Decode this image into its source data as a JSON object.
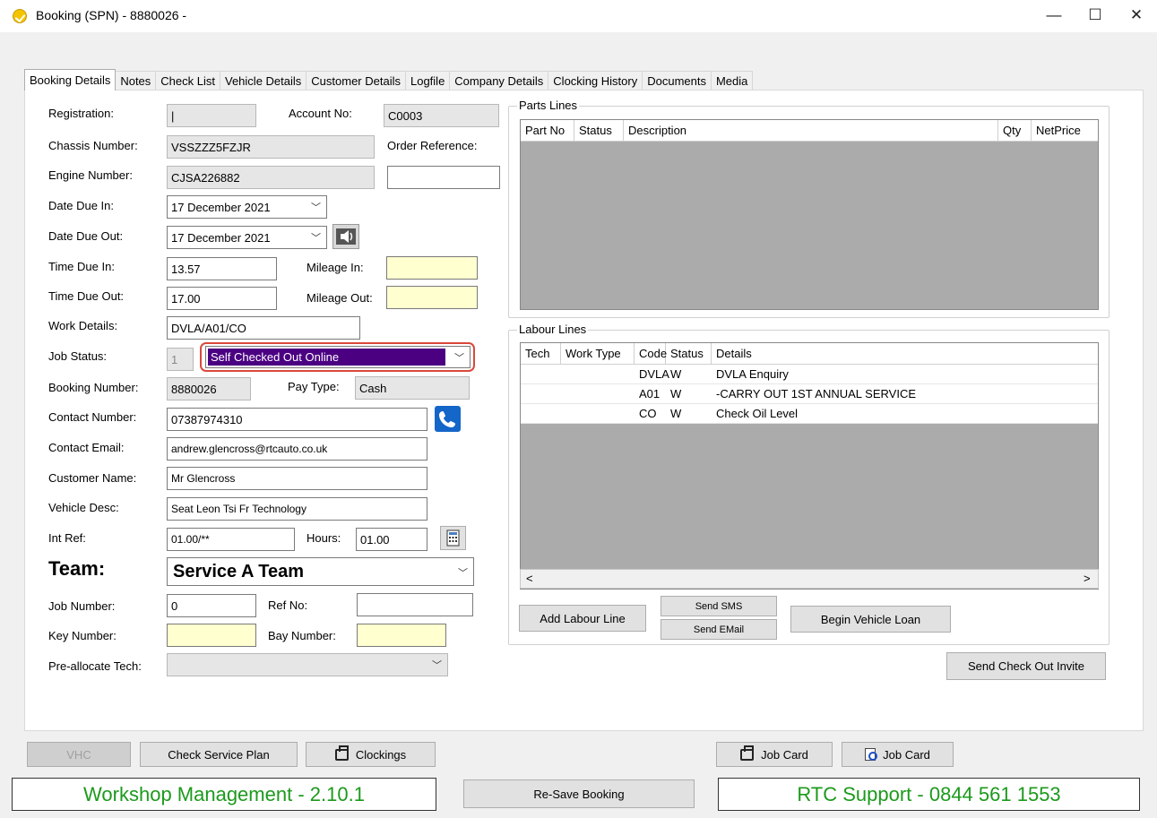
{
  "window": {
    "title": "Booking (SPN) - 8880026 -",
    "minimize": "—",
    "maximize": "☐",
    "close": "✕"
  },
  "tabs": [
    "Booking Details",
    "Notes",
    "Check List",
    "Vehicle Details",
    "Customer Details",
    "Logfile",
    "Company Details",
    "Clocking History",
    "Documents",
    "Media"
  ],
  "form": {
    "registration_label": "Registration:",
    "registration": "|",
    "account_no_label": "Account No:",
    "account_no": "C0003",
    "chassis_label": "Chassis Number:",
    "chassis": "VSSZZZ5FZJR",
    "order_ref_label": "Order Reference:",
    "order_ref": "",
    "engine_label": "Engine Number:",
    "engine": "CJSA226882",
    "date_in_label": "Date Due In:",
    "date_in": "17 December 2021",
    "date_out_label": "Date Due Out:",
    "date_out": "17 December 2021",
    "time_in_label": "Time Due In:",
    "time_in": "13.57",
    "mileage_in_label": "Mileage In:",
    "mileage_in": "",
    "time_out_label": "Time Due Out:",
    "time_out": "17.00",
    "mileage_out_label": "Mileage Out:",
    "mileage_out": "",
    "work_details_label": "Work Details:",
    "work_details": "DVLA/A01/CO",
    "job_status_label": "Job Status:",
    "job_status_code": "1",
    "job_status": "Self Checked Out Online",
    "booking_number_label": "Booking Number:",
    "booking_number": "8880026",
    "pay_type_label": "Pay Type:",
    "pay_type": "Cash",
    "contact_number_label": "Contact Number:",
    "contact_number": "07387974310",
    "contact_email_label": "Contact Email:",
    "contact_email": "andrew.glencross@rtcauto.co.uk",
    "customer_name_label": "Customer Name:",
    "customer_name": "Mr Glencross",
    "vehicle_desc_label": "Vehicle Desc:",
    "vehicle_desc": "Seat Leon Tsi Fr Technology",
    "int_ref_label": "Int Ref:",
    "int_ref": "01.00/**",
    "hours_label": "Hours:",
    "hours": "01.00",
    "team_label": "Team:",
    "team": "Service A Team",
    "job_number_label": "Job Number:",
    "job_number": "0",
    "ref_no_label": "Ref No:",
    "ref_no": "",
    "key_number_label": "Key Number:",
    "key_number": "",
    "bay_number_label": "Bay Number:",
    "bay_number": "",
    "prealloc_label": "Pre-allocate Tech:",
    "prealloc": ""
  },
  "parts": {
    "title": "Parts Lines",
    "columns": [
      "Part No",
      "Status",
      "Description",
      "Qty",
      "NetPrice"
    ]
  },
  "labour": {
    "title": "Labour Lines",
    "columns": [
      "Tech",
      "Work Type",
      "Code",
      "Status",
      "Details"
    ],
    "rows": [
      {
        "tech": "",
        "work_type": "",
        "code": "DVLA",
        "status": "W",
        "details": "DVLA Enquiry"
      },
      {
        "tech": "",
        "work_type": "",
        "code": "A01",
        "status": "W",
        "details": "-CARRY OUT 1ST ANNUAL SERVICE"
      },
      {
        "tech": "",
        "work_type": "",
        "code": "CO",
        "status": "W",
        "details": "Check Oil Level"
      }
    ]
  },
  "buttons": {
    "add_labour": "Add Labour Line",
    "send_sms": "Send SMS",
    "send_email": "Send EMail",
    "begin_loan": "Begin Vehicle Loan",
    "send_checkout": "Send Check Out Invite",
    "vhc": "VHC",
    "check_service_plan": "Check Service Plan",
    "clockings": "Clockings",
    "job_card_print": "Job Card",
    "job_card_preview": "Job Card",
    "resave": "Re-Save Booking"
  },
  "footer": {
    "left": "Workshop Management - 2.10.1",
    "right": "RTC Support - 0844 561 1553"
  },
  "colors": {
    "status_bg": "#4b0082",
    "highlight": "#d9483b",
    "footer_text": "#1c9a1c"
  }
}
